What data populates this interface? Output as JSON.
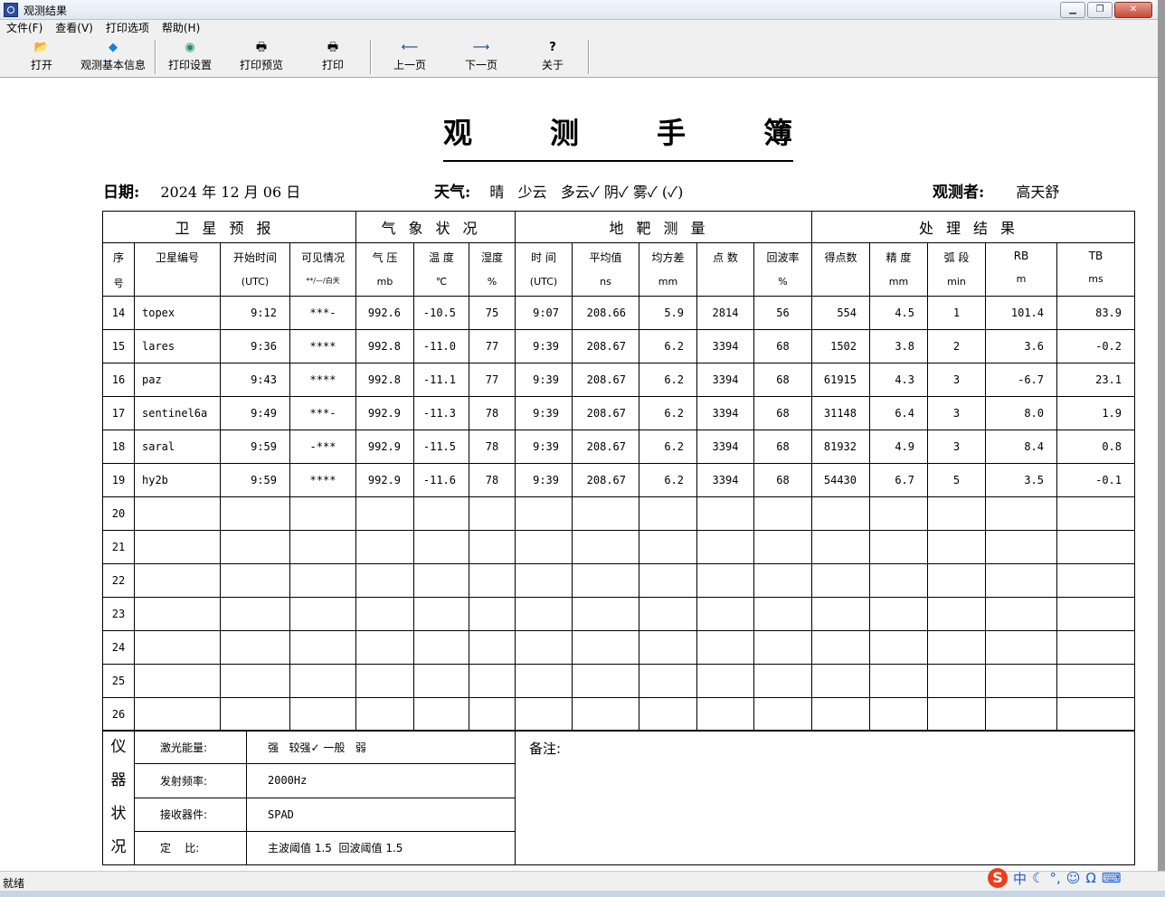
{
  "window": {
    "title": "观测结果"
  },
  "menu": [
    "文件(F)",
    "查看(V)",
    "打印选项",
    "帮助(H)"
  ],
  "toolbar": [
    {
      "label": "打开",
      "icon": "folder-open-icon"
    },
    {
      "label": "观测基本信息",
      "icon": "diamond-icon"
    },
    {
      "label": "打印设置",
      "icon": "printer-settings-icon"
    },
    {
      "label": "打印预览",
      "icon": "print-preview-icon"
    },
    {
      "label": "打印",
      "icon": "printer-icon"
    },
    {
      "label": "上一页",
      "icon": "arrow-left-icon"
    },
    {
      "label": "下一页",
      "icon": "arrow-right-icon"
    },
    {
      "label": "关于",
      "icon": "help-icon"
    }
  ],
  "doc": {
    "title_chars": [
      "观",
      "测",
      "手",
      "簿"
    ],
    "date_label": "日期:",
    "date_value": "2024 年 12 月 06 日",
    "weather_label": "天气:",
    "weather_value": "晴   少云   多云✓ 阴✓ 雾✓ (✓)",
    "observer_label": "观测者:",
    "observer_value": "高天舒"
  },
  "sections": [
    "卫星预报",
    "气象状况",
    "地靶测量",
    "处理结果"
  ],
  "columns": [
    {
      "l1": "序",
      "l2": "号"
    },
    {
      "l1": "卫星编号",
      "l2": ""
    },
    {
      "l1": "开始时间",
      "l2": "(UTC)"
    },
    {
      "l1": "可见情况",
      "l2": "**/—/白天"
    },
    {
      "l1": "气 压",
      "l2": "mb"
    },
    {
      "l1": "温 度",
      "l2": "℃"
    },
    {
      "l1": "湿度",
      "l2": "%"
    },
    {
      "l1": "时 间",
      "l2": "(UTC)"
    },
    {
      "l1": "平均值",
      "l2": "ns"
    },
    {
      "l1": "均方差",
      "l2": "mm"
    },
    {
      "l1": "点 数",
      "l2": ""
    },
    {
      "l1": "回波率",
      "l2": "%"
    },
    {
      "l1": "得点数",
      "l2": ""
    },
    {
      "l1": "精 度",
      "l2": "mm"
    },
    {
      "l1": "弧 段",
      "l2": "min"
    },
    {
      "l1": "RB",
      "l2": "m"
    },
    {
      "l1": "TB",
      "l2": "ms"
    }
  ],
  "rows": [
    [
      "14",
      "topex",
      "9:12",
      "***-",
      "992.6",
      "-10.5",
      "75",
      "9:07",
      "208.66",
      "5.9",
      "2814",
      "56",
      "554",
      "4.5",
      "1",
      "101.4",
      "83.9"
    ],
    [
      "15",
      "lares",
      "9:36",
      "****",
      "992.8",
      "-11.0",
      "77",
      "9:39",
      "208.67",
      "6.2",
      "3394",
      "68",
      "1502",
      "3.8",
      "2",
      "3.6",
      "-0.2"
    ],
    [
      "16",
      "paz",
      "9:43",
      "****",
      "992.8",
      "-11.1",
      "77",
      "9:39",
      "208.67",
      "6.2",
      "3394",
      "68",
      "61915",
      "4.3",
      "3",
      "-6.7",
      "23.1"
    ],
    [
      "17",
      "sentinel6a",
      "9:49",
      "***-",
      "992.9",
      "-11.3",
      "78",
      "9:39",
      "208.67",
      "6.2",
      "3394",
      "68",
      "31148",
      "6.4",
      "3",
      "8.0",
      "1.9"
    ],
    [
      "18",
      "saral",
      "9:59",
      "-***",
      "992.9",
      "-11.5",
      "78",
      "9:39",
      "208.67",
      "6.2",
      "3394",
      "68",
      "81932",
      "4.9",
      "3",
      "8.4",
      "0.8"
    ],
    [
      "19",
      "hy2b",
      "9:59",
      "****",
      "992.9",
      "-11.6",
      "78",
      "9:39",
      "208.67",
      "6.2",
      "3394",
      "68",
      "54430",
      "6.7",
      "5",
      "3.5",
      "-0.1"
    ],
    [
      "20",
      "",
      "",
      "",
      "",
      "",
      "",
      "",
      "",
      "",
      "",
      "",
      "",
      "",
      "",
      "",
      ""
    ],
    [
      "21",
      "",
      "",
      "",
      "",
      "",
      "",
      "",
      "",
      "",
      "",
      "",
      "",
      "",
      "",
      "",
      ""
    ],
    [
      "22",
      "",
      "",
      "",
      "",
      "",
      "",
      "",
      "",
      "",
      "",
      "",
      "",
      "",
      "",
      "",
      ""
    ],
    [
      "23",
      "",
      "",
      "",
      "",
      "",
      "",
      "",
      "",
      "",
      "",
      "",
      "",
      "",
      "",
      "",
      ""
    ],
    [
      "24",
      "",
      "",
      "",
      "",
      "",
      "",
      "",
      "",
      "",
      "",
      "",
      "",
      "",
      "",
      "",
      ""
    ],
    [
      "25",
      "",
      "",
      "",
      "",
      "",
      "",
      "",
      "",
      "",
      "",
      "",
      "",
      "",
      "",
      "",
      ""
    ],
    [
      "26",
      "",
      "",
      "",
      "",
      "",
      "",
      "",
      "",
      "",
      "",
      "",
      "",
      "",
      "",
      "",
      ""
    ]
  ],
  "instrument": {
    "vlabel": [
      "仪",
      "器",
      "状",
      "况"
    ],
    "items": [
      {
        "label": "激光能量:",
        "value": "强   较强✓ 一般   弱"
      },
      {
        "label": "发射频率:",
        "value": "2000Hz"
      },
      {
        "label": "接收器件:",
        "value": "SPAD"
      },
      {
        "label": "定    比:",
        "value": "主波阈值 1.5  回波阈值 1.5"
      }
    ],
    "remark_label": "备注:"
  },
  "status": {
    "text": "就绪"
  },
  "ime": {
    "logo": "S",
    "lang": "中"
  }
}
